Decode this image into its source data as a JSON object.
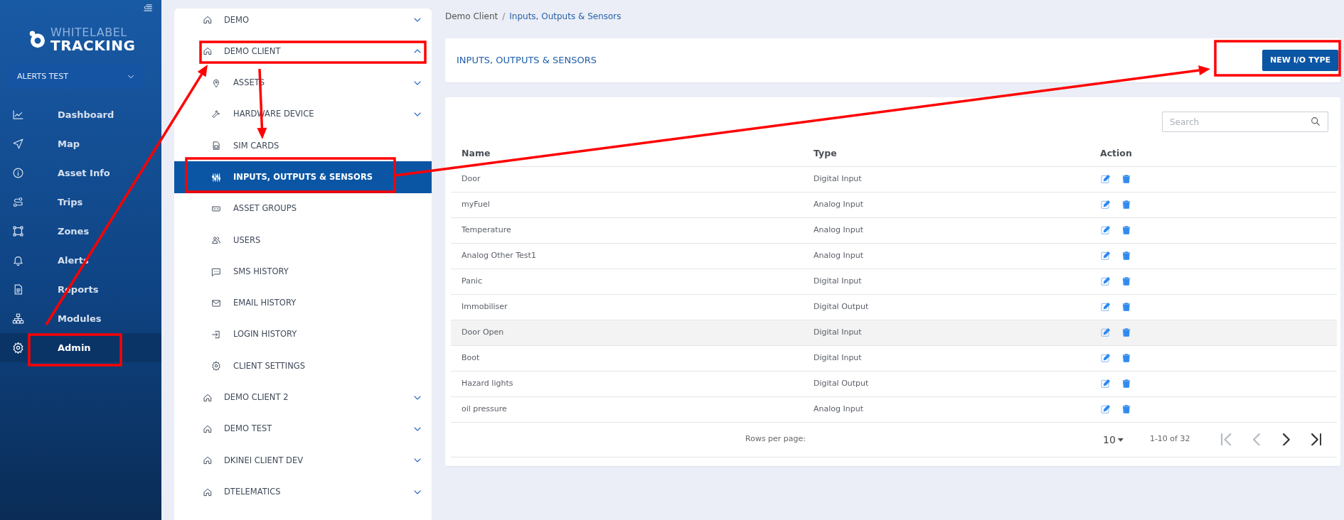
{
  "sidebar": {
    "brand": {
      "line_1": "WHITELABEL",
      "line_2": "TRACKING"
    },
    "account": {
      "value": "ALERTS TEST"
    },
    "items": [
      {
        "label": "Dashboard",
        "selected": false
      },
      {
        "label": "Map",
        "selected": false
      },
      {
        "label": "Asset Info",
        "selected": false
      },
      {
        "label": "Trips",
        "selected": false
      },
      {
        "label": "Zones",
        "selected": false
      },
      {
        "label": "Alerts",
        "selected": false
      },
      {
        "label": "Reports",
        "selected": false
      },
      {
        "label": "Modules",
        "selected": false
      },
      {
        "label": "Admin",
        "selected": true
      }
    ]
  },
  "admin_tree": [
    {
      "label": "DEMO",
      "expanded": false
    },
    {
      "label": "DEMO CLIENT",
      "expanded": true,
      "children": [
        {
          "label": "ASSETS",
          "kind": "group",
          "expanded": false,
          "selected": false
        },
        {
          "label": "HARDWARE DEVICE",
          "kind": "group",
          "expanded": false,
          "selected": false
        },
        {
          "label": "SIM CARDS",
          "kind": "link",
          "selected": false
        },
        {
          "label": "INPUTS, OUTPUTS & SENSORS",
          "kind": "link",
          "selected": true
        },
        {
          "label": "ASSET GROUPS",
          "kind": "link",
          "selected": false
        },
        {
          "label": "USERS",
          "kind": "link",
          "selected": false
        },
        {
          "label": "SMS HISTORY",
          "kind": "link",
          "selected": false
        },
        {
          "label": "EMAIL HISTORY",
          "kind": "link",
          "selected": false
        },
        {
          "label": "LOGIN HISTORY",
          "kind": "link",
          "selected": false
        },
        {
          "label": "CLIENT SETTINGS",
          "kind": "link",
          "selected": false
        }
      ]
    },
    {
      "label": "DEMO CLIENT 2",
      "expanded": false
    },
    {
      "label": "DEMO TEST",
      "expanded": false
    },
    {
      "label": "DKINEI CLIENT DEV",
      "expanded": false
    },
    {
      "label": "DTELEMATICS",
      "expanded": false
    }
  ],
  "breadcrumb": [
    {
      "label": "Demo Client",
      "current": false
    },
    {
      "label": "Inputs, Outputs & Sensors",
      "current": true
    }
  ],
  "breadcrumb_separator": "/",
  "page_title": "INPUTS, OUTPUTS & SENSORS",
  "new_button": "NEW I/O TYPE",
  "search": {
    "placeholder": "Search"
  },
  "table": {
    "columns": [
      "Name",
      "Type",
      "Action"
    ],
    "rows": [
      {
        "name": "Door",
        "type": "Digital Input",
        "highlighted": false
      },
      {
        "name": "myFuel",
        "type": "Analog Input",
        "highlighted": false
      },
      {
        "name": "Temperature",
        "type": "Analog Input",
        "highlighted": false
      },
      {
        "name": "Analog Other Test1",
        "type": "Analog Input",
        "highlighted": false
      },
      {
        "name": "Panic",
        "type": "Digital Input",
        "highlighted": false
      },
      {
        "name": "Immobiliser",
        "type": "Digital Output",
        "highlighted": false
      },
      {
        "name": "Door Open",
        "type": "Digital Input",
        "highlighted": true
      },
      {
        "name": "Boot",
        "type": "Digital Input",
        "highlighted": false
      },
      {
        "name": "Hazard lights",
        "type": "Digital Output",
        "highlighted": false
      },
      {
        "name": "oil pressure",
        "type": "Analog Input",
        "highlighted": false
      }
    ]
  },
  "pagination": {
    "rows_per_page_label": "Rows per page:",
    "rows_per_page": "10",
    "range": "1-10 of 32",
    "buttons": [
      {
        "kind": "first",
        "disabled": true
      },
      {
        "kind": "prev",
        "disabled": true
      },
      {
        "kind": "next",
        "disabled": false
      },
      {
        "kind": "last",
        "disabled": false
      }
    ]
  }
}
